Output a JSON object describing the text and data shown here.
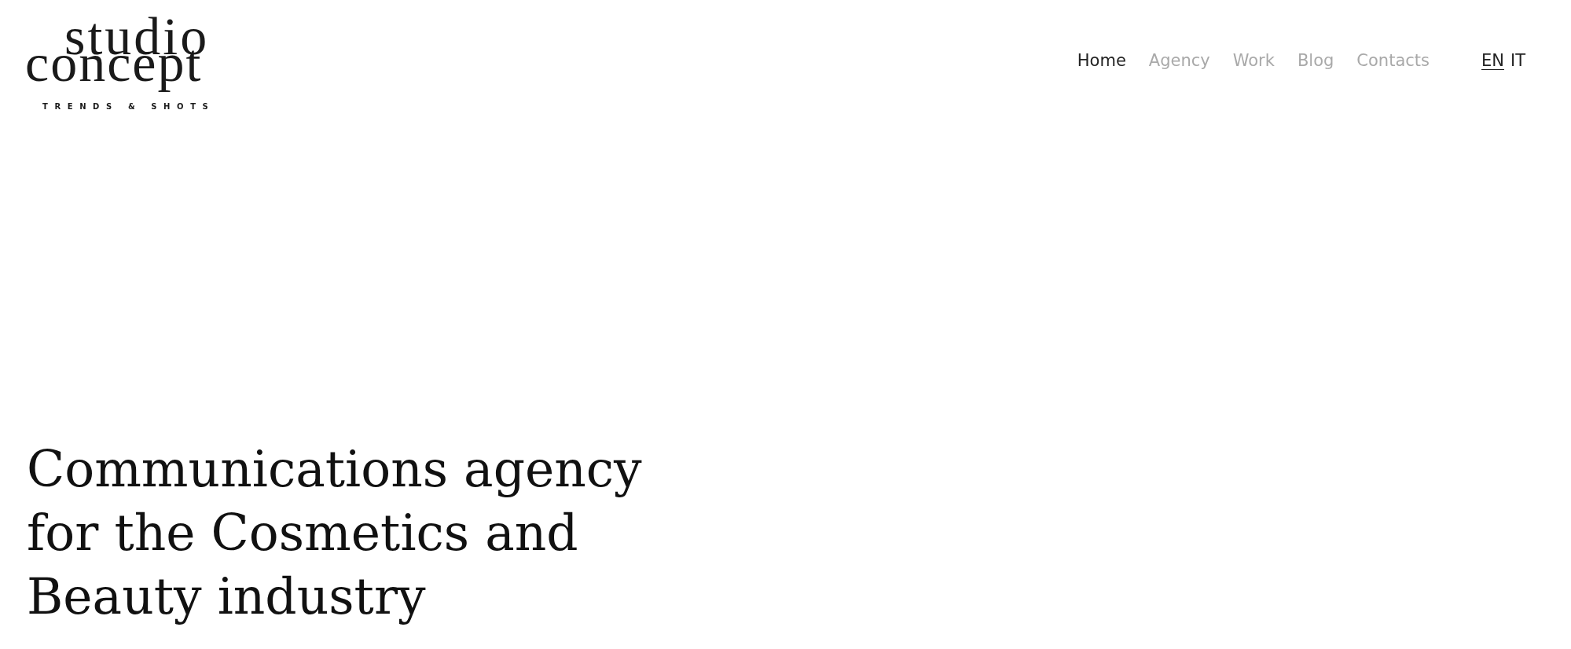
{
  "logo": {
    "line_1": "studio",
    "line_2": "concept",
    "tagline": "TRENDS & SHOTS"
  },
  "nav": {
    "items": [
      {
        "label": "Home",
        "selected": true
      },
      {
        "label": "Agency",
        "selected": false
      },
      {
        "label": "Work",
        "selected": false
      },
      {
        "label": "Blog",
        "selected": false
      },
      {
        "label": "Contacts",
        "selected": false
      }
    ],
    "languages": [
      {
        "label": "EN",
        "selected": true
      },
      {
        "label": "IT",
        "selected": false
      }
    ]
  },
  "hero": {
    "heading": "Communications agency for the Cosmetics and Beauty industry"
  }
}
